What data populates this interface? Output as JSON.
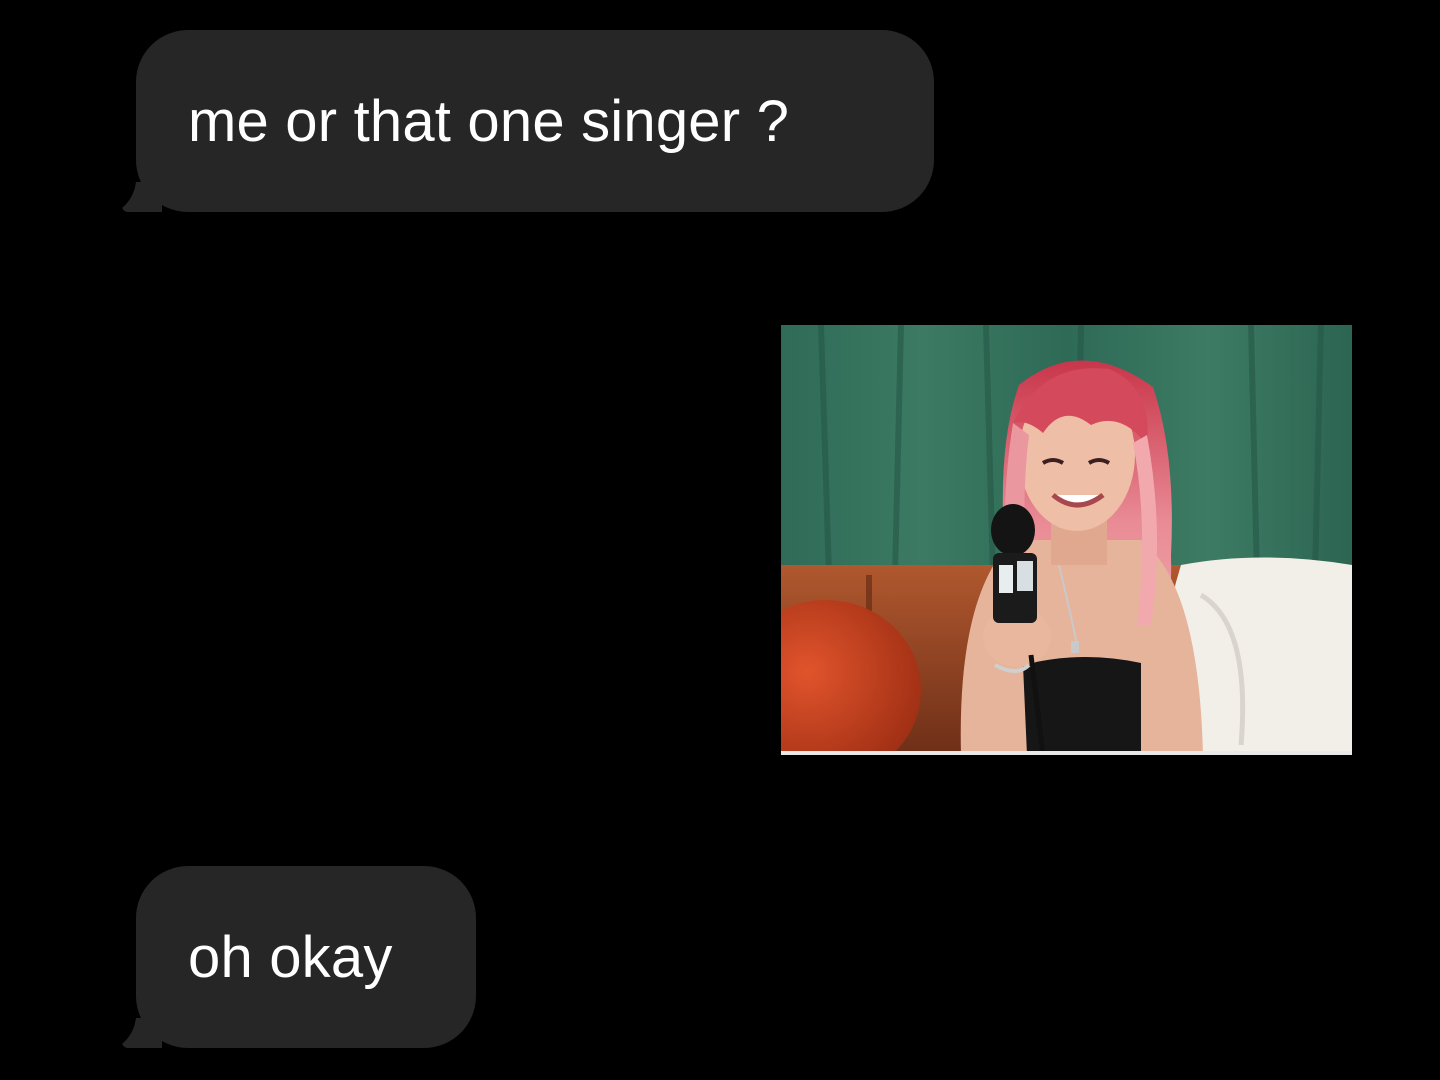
{
  "chat": {
    "messages": [
      {
        "text": "me or that one singer ?"
      },
      {
        "text": "oh okay"
      }
    ],
    "media_image": {
      "icon": "photo-icon"
    }
  },
  "colors": {
    "background": "#000000",
    "bubble_received": "#262626",
    "text": "#ffffff"
  }
}
